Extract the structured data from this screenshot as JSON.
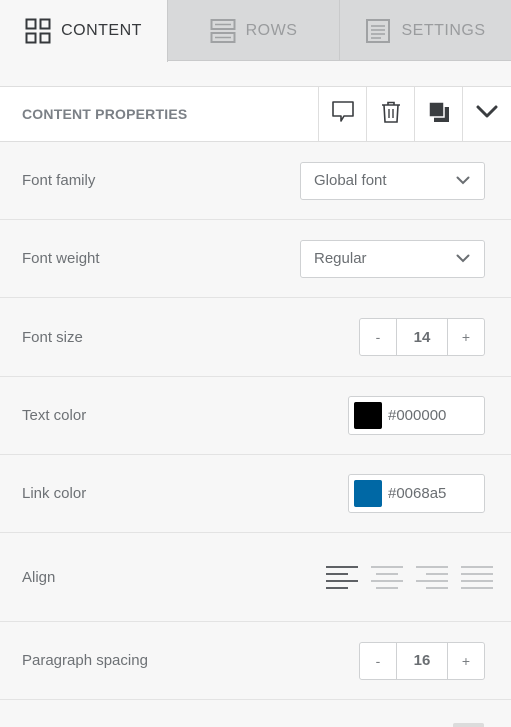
{
  "tabs": [
    {
      "label": "CONTENT",
      "icon": "grid-icon",
      "active": true
    },
    {
      "label": "ROWS",
      "icon": "rows-icon",
      "active": false
    },
    {
      "label": "SETTINGS",
      "icon": "settings-doc-icon",
      "active": false
    }
  ],
  "header": {
    "title": "CONTENT PROPERTIES",
    "actions": [
      "comment-icon",
      "trash-icon",
      "duplicate-icon",
      "chevron-down-icon"
    ]
  },
  "properties": {
    "font_family": {
      "label": "Font family",
      "value": "Global font"
    },
    "font_weight": {
      "label": "Font weight",
      "value": "Regular"
    },
    "font_size": {
      "label": "Font size",
      "value": "14",
      "minus": "-",
      "plus": "+"
    },
    "text_color": {
      "label": "Text color",
      "value": "#000000"
    },
    "link_color": {
      "label": "Link color",
      "value": "#0068a5"
    },
    "align": {
      "label": "Align",
      "options": [
        "left",
        "center",
        "right",
        "justify"
      ],
      "selected": "left"
    },
    "paragraph_spacing": {
      "label": "Paragraph spacing",
      "value": "16",
      "minus": "-",
      "plus": "+"
    }
  },
  "colors": {
    "accent_text": "#000000",
    "accent_link": "#0068a5"
  }
}
